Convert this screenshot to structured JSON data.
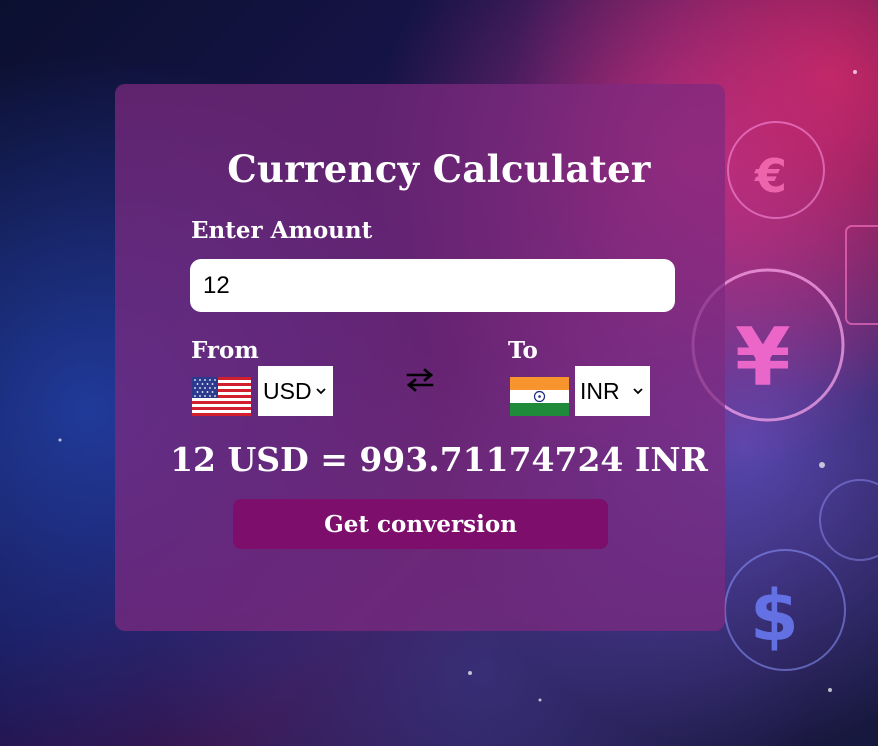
{
  "page": {
    "title": "Currency Calculater"
  },
  "amount": {
    "label": "Enter Amount",
    "value": "12"
  },
  "from": {
    "label": "From",
    "currency": "USD",
    "flag_icon": "us-flag-icon"
  },
  "to": {
    "label": "To",
    "currency": "INR",
    "flag_icon": "india-flag-icon"
  },
  "swap_icon": "swap-arrows-icon",
  "result_text": "12 USD = 993.71174724 INR",
  "button": {
    "label": "Get conversion"
  },
  "colors": {
    "card": "#7e2a80",
    "button": "#7d0e6c",
    "text": "#ffffff"
  }
}
